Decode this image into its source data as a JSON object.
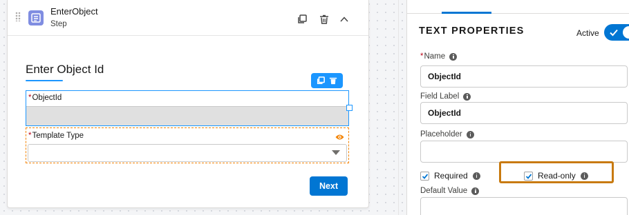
{
  "step": {
    "name": "EnterObject",
    "type_label": "Step",
    "form_title": "Enter Object Id",
    "fields": [
      {
        "label": "ObjectId",
        "required": true,
        "value": ""
      },
      {
        "label": "Template Type",
        "required": true,
        "value": ""
      }
    ],
    "next_label": "Next"
  },
  "properties": {
    "title": "TEXT PROPERTIES",
    "active_label": "Active",
    "active": true,
    "name_label": "Name",
    "name_value": "ObjectId",
    "field_label_label": "Field Label",
    "field_label_value": "ObjectId",
    "placeholder_label": "Placeholder",
    "placeholder_value": "",
    "required_label": "Required",
    "required_checked": true,
    "readonly_label": "Read-only",
    "readonly_checked": true,
    "default_value_label": "Default Value",
    "default_value": ""
  },
  "colors": {
    "accent": "#0176d3",
    "highlight": "#c87a0f",
    "required_star": "#ba0517"
  },
  "icons": [
    "drag-handle-icon",
    "step-form-icon",
    "copy-icon",
    "delete-icon",
    "chevron-up-icon",
    "eye-icon",
    "info-icon",
    "checkmark-icon",
    "caret-down-icon"
  ]
}
